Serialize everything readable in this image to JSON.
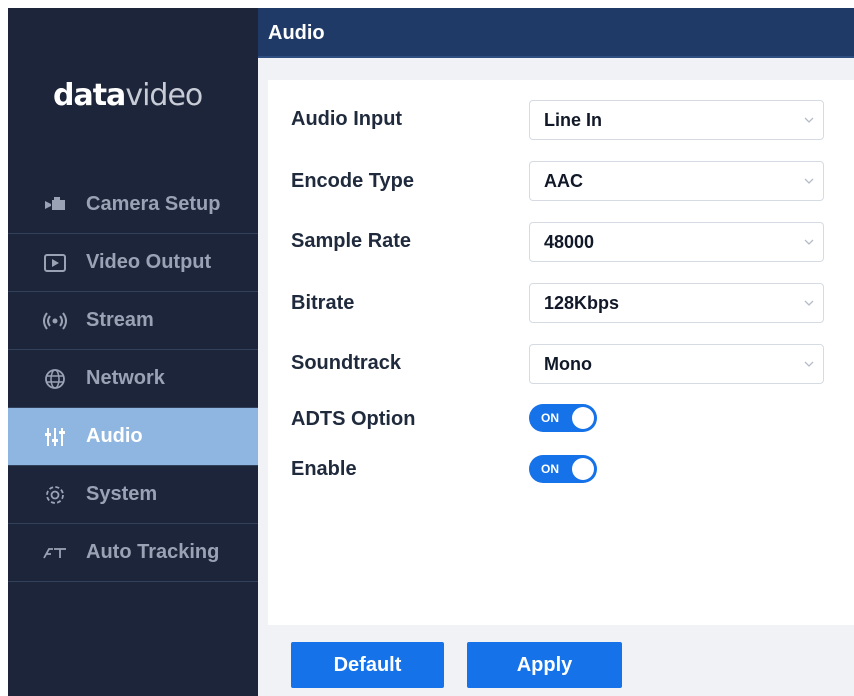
{
  "brand": {
    "logo_bold": "data",
    "logo_light": "video"
  },
  "sidebar": {
    "items": [
      {
        "label": "Camera Setup",
        "icon": "camera-icon",
        "active": false
      },
      {
        "label": "Video Output",
        "icon": "video-output-icon",
        "active": false
      },
      {
        "label": "Stream",
        "icon": "stream-icon",
        "active": false
      },
      {
        "label": "Network",
        "icon": "globe-icon",
        "active": false
      },
      {
        "label": "Audio",
        "icon": "equalizer-icon",
        "active": true
      },
      {
        "label": "System",
        "icon": "gear-icon",
        "active": false
      },
      {
        "label": "Auto Tracking",
        "icon": "auto-tracking-icon",
        "active": false
      }
    ]
  },
  "header": {
    "title": "Audio"
  },
  "form": {
    "audio_input": {
      "label": "Audio Input",
      "value": "Line In"
    },
    "encode_type": {
      "label": "Encode Type",
      "value": "AAC"
    },
    "sample_rate": {
      "label": "Sample Rate",
      "value": "48000"
    },
    "bitrate": {
      "label": "Bitrate",
      "value": "128Kbps"
    },
    "soundtrack": {
      "label": "Soundtrack",
      "value": "Mono"
    },
    "adts_option": {
      "label": "ADTS Option",
      "state": "ON"
    },
    "enable": {
      "label": "Enable",
      "state": "ON"
    }
  },
  "actions": {
    "default_label": "Default",
    "apply_label": "Apply"
  },
  "colors": {
    "sidebar_bg": "#1c2539",
    "header_bg": "#1f3a66",
    "active_item": "#8fb6e0",
    "accent": "#1572e8"
  }
}
